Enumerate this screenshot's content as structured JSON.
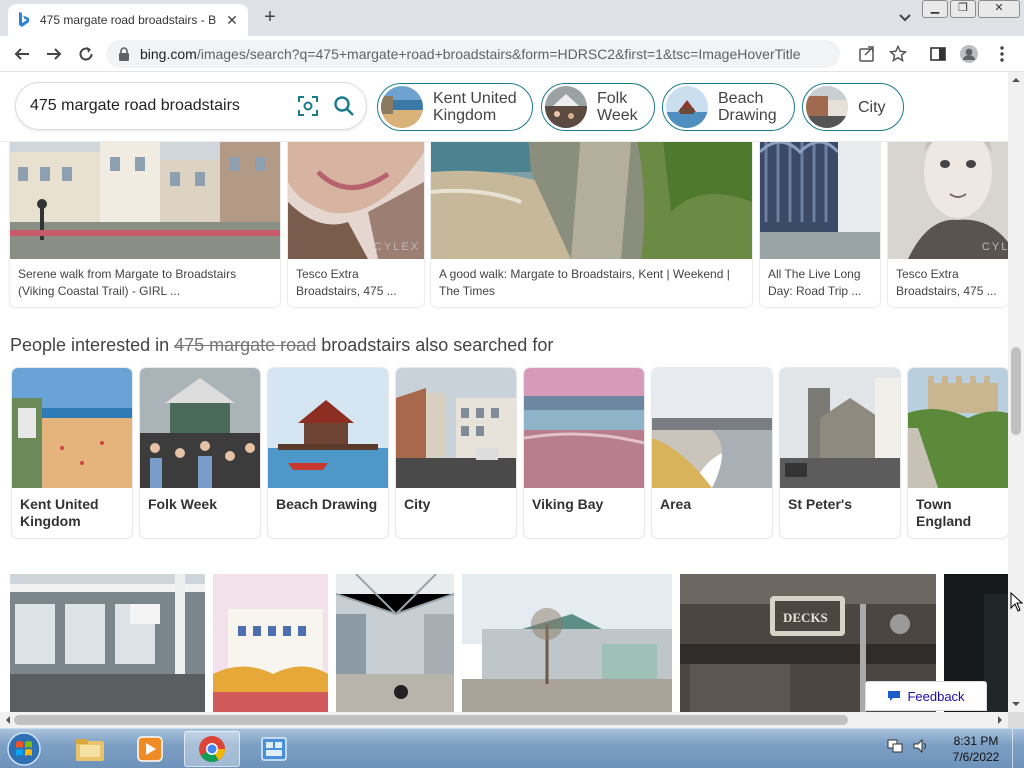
{
  "browser": {
    "tab_title": "475 margate road broadstairs - B",
    "url_host": "bing.com",
    "url_path": "/images/search?q=475+margate+road+broadstairs&form=HDRSC2&first=1&tsc=ImageHoverTitle"
  },
  "search": {
    "query": "475 margate road broadstairs"
  },
  "pills": [
    {
      "label_line1": "Kent United",
      "label_line2": "Kingdom"
    },
    {
      "label_line1": "Folk",
      "label_line2": "Week"
    },
    {
      "label_line1": "Beach",
      "label_line2": "Drawing"
    },
    {
      "label_line1": "City",
      "label_line2": ""
    }
  ],
  "top_cards": [
    {
      "caption": "Serene walk from Margate to Broadstairs (Viking Coastal Trail) - GIRL ..."
    },
    {
      "caption": "Tesco Extra Broadstairs, 475 ..."
    },
    {
      "caption": "A good walk: Margate to Broadstairs, Kent | Weekend | The Times"
    },
    {
      "caption": "All The Live Long Day: Road Trip ..."
    },
    {
      "caption": "Tesco Extra Broadstairs, 475 ..."
    }
  ],
  "watermark": "CYLEX",
  "related": {
    "heading_pre": "People interested in ",
    "heading_strike": "475 margate road",
    "heading_post": " broadstairs also searched for",
    "items": [
      {
        "label": "Kent United Kingdom"
      },
      {
        "label": "Folk Week"
      },
      {
        "label": "Beach Drawing"
      },
      {
        "label": "City"
      },
      {
        "label": "Viking Bay"
      },
      {
        "label": "Area"
      },
      {
        "label": "St Peter's"
      },
      {
        "label": "Town England"
      }
    ]
  },
  "feedback_label": "Feedback",
  "taskbar": {
    "time": "8:31 PM",
    "date": "7/6/2022"
  }
}
